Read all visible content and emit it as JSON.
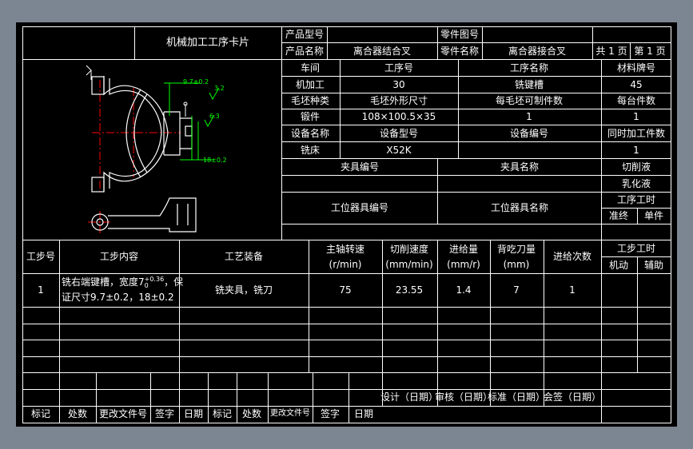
{
  "header": {
    "card_title": "机械加工工序卡片",
    "product_model_label": "产品型号",
    "product_model_value": "",
    "part_drawing_label": "零件图号",
    "part_drawing_value": "",
    "product_name_label": "产品名称",
    "product_name_value": "离合器结合叉",
    "part_name_label": "零件名称",
    "part_name_value": "离合器接合叉",
    "total_pages": "共 1 页",
    "page_no": "第 1 页"
  },
  "process_info": {
    "workshop_label": "车间",
    "workshop_value": "机加工",
    "op_no_label": "工序号",
    "op_no_value": "30",
    "op_name_label": "工序名称",
    "op_name_value": "铣键槽",
    "material_label": "材料牌号",
    "material_value": "45",
    "blank_type_label": "毛坯种类",
    "blank_type_value": "锻件",
    "blank_size_label": "毛坯外形尺寸",
    "blank_size_value": "108×100.5×35",
    "parts_per_blank_label": "每毛坯可制件数",
    "parts_per_blank_value": "1",
    "parts_per_machine_label": "每台件数",
    "parts_per_machine_value": "1",
    "equip_name_label": "设备名称",
    "equip_name_value": "铣床",
    "equip_model_label": "设备型号",
    "equip_model_value": "X52K",
    "equip_no_label": "设备编号",
    "equip_no_value": "",
    "concurrent_label": "同时加工件数",
    "concurrent_value": "1",
    "fixture_no_label": "夹具编号",
    "fixture_name_label": "夹具名称",
    "coolant_label": "切削液",
    "coolant_value": "乳化液",
    "station_tool_no_label": "工位器具编号",
    "station_tool_name_label": "工位器具名称",
    "op_time_label": "工序工时",
    "prep_end_label": "准终",
    "unit_label": "单件"
  },
  "drawing": {
    "dim_top": "9.7±0.2",
    "dim_right": "18±0.2",
    "rough_1": "3.2",
    "rough_2": "6.3"
  },
  "steps_header": {
    "step_no": "工步号",
    "step_content": "工步内容",
    "equipment": "工艺装备",
    "spindle_speed": "主轴转速",
    "spindle_speed_unit": "(r/min)",
    "cutting_speed": "切削速度",
    "cutting_speed_unit": "(mm/min)",
    "feed": "进给量",
    "feed_unit": "(mm/r)",
    "depth": "背吃刀量",
    "depth_unit": "(mm)",
    "passes": "进给次数",
    "step_time": "工步工时",
    "machine_time": "机动",
    "aux_time": "辅助"
  },
  "steps": [
    {
      "no": "1",
      "content_line1": "铣右端键槽，宽度7",
      "content_tol_upper": "+0.36",
      "content_tol_lower": "0",
      "content_line1_tail": "，保",
      "content_line2": "证尺寸9.7±0.2，18±0.2",
      "equipment": "铣夹具，铣刀",
      "spindle_speed": "75",
      "cutting_speed": "23.55",
      "feed": "1.4",
      "depth": "7",
      "passes": "1"
    }
  ],
  "signoff": {
    "design": "设计（日期）",
    "review": "审核（日期）",
    "standard": "标准（日期）",
    "countersign": "会签（日期）"
  },
  "footer": {
    "mark": "标记",
    "count": "处数",
    "doc_no": "更改文件号",
    "sign": "签字",
    "date": "日期",
    "mark2": "标记",
    "count2": "处数",
    "doc_no2": "更改文件号",
    "sign2": "签字",
    "date2": "日期"
  },
  "colors": {
    "line": "#ffffff",
    "dim": "#00ff00",
    "center": "#ff0000",
    "sheet_bg": "#000000",
    "frame_bg": "#7c8592"
  }
}
